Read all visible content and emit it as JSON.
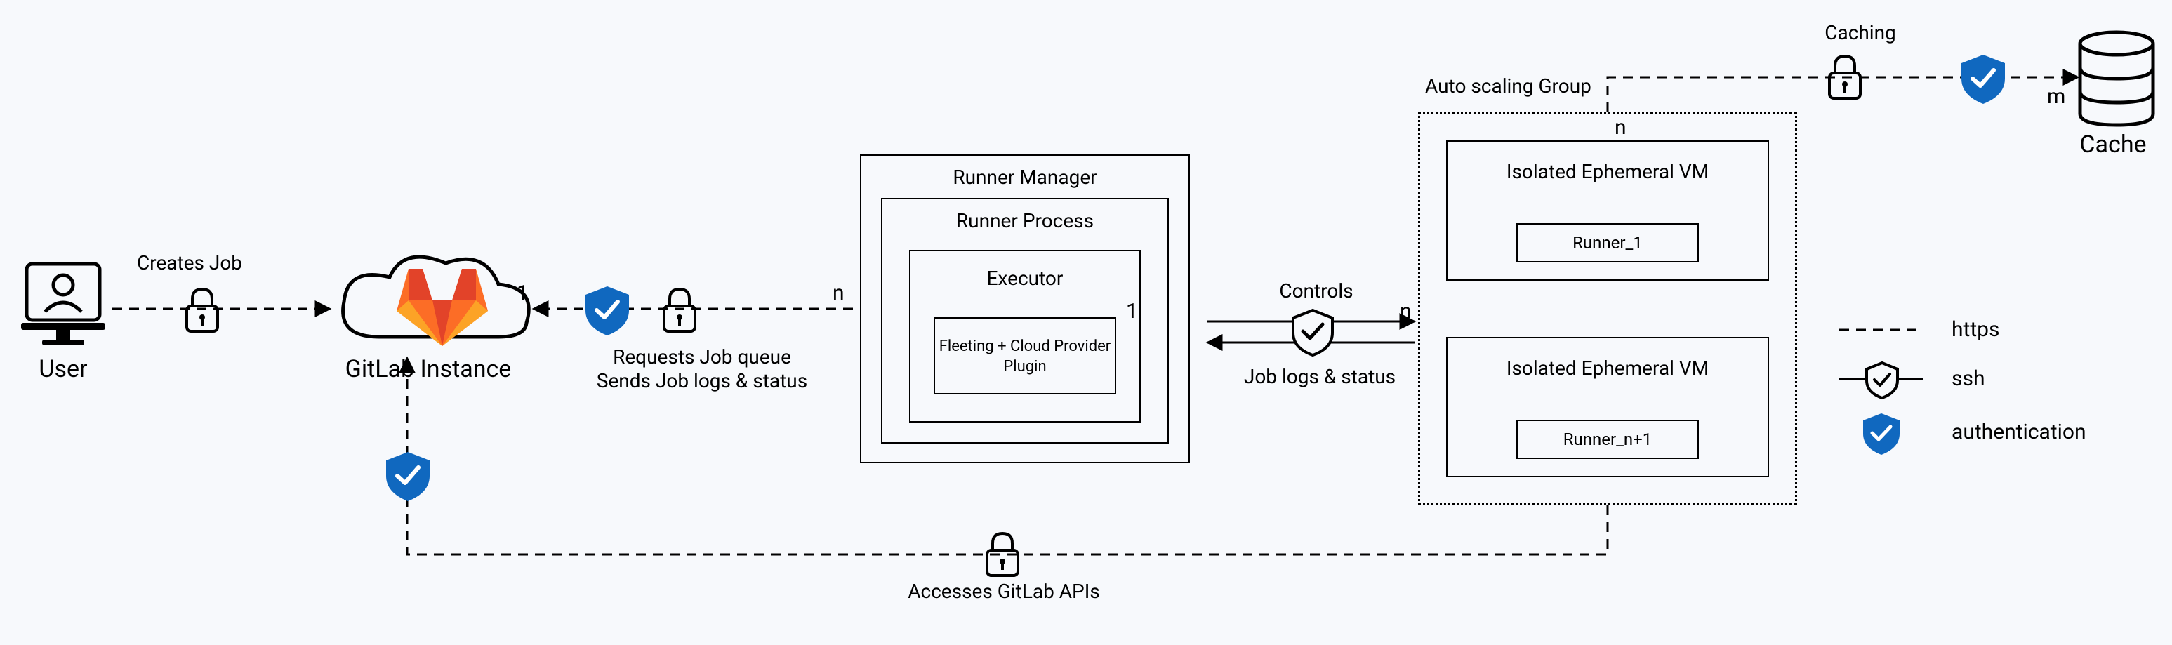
{
  "nodes": {
    "user": "User",
    "gitlab": "GitLab Instance",
    "runner_manager": "Runner Manager",
    "runner_process": "Runner Process",
    "executor": "Executor",
    "executor_plugin": "Fleeting + Cloud Provider Plugin",
    "auto_scaling_group": "Auto scaling Group",
    "vm1_title": "Isolated Ephemeral VM",
    "vm1_runner": "Runner_1",
    "vm2_title": "Isolated Ephemeral VM",
    "vm2_runner": "Runner_n+1",
    "cache": "Cache"
  },
  "edges": {
    "creates_job": "Creates Job",
    "requests_queue_l1": "Requests Job queue",
    "requests_queue_l2": "Sends Job logs & status",
    "controls": "Controls",
    "job_logs_status": "Job logs & status",
    "accesses_apis": "Accesses GitLab APIs",
    "caching": "Caching"
  },
  "multiplicity": {
    "gitlab_side": "1",
    "manager_side": "n",
    "manager_right": "1",
    "group_left": "n",
    "group_top": "n",
    "cache_left": "m"
  },
  "legend": {
    "https": "https",
    "ssh": "ssh",
    "auth": "authentication"
  },
  "colors": {
    "gitlab_orange": "#fc6d26",
    "shield_blue": "#1068bf",
    "black": "#000"
  }
}
